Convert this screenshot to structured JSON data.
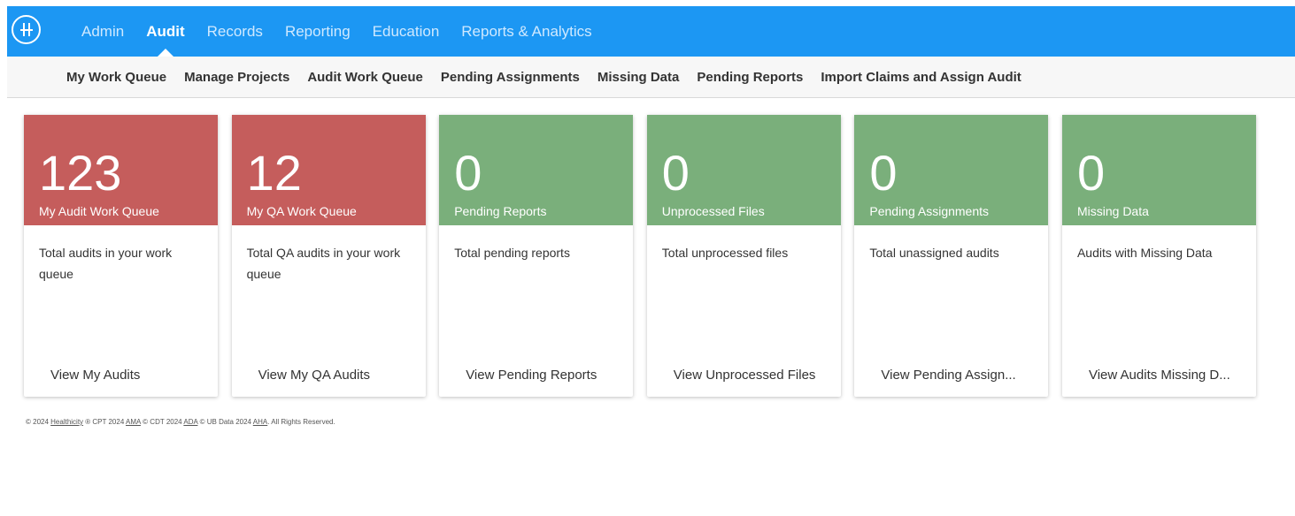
{
  "colors": {
    "topbar": "#1c97f3",
    "red": "#c55d5c",
    "green": "#7aaf7b"
  },
  "mainnav": [
    {
      "label": "Admin",
      "active": false
    },
    {
      "label": "Audit",
      "active": true
    },
    {
      "label": "Records",
      "active": false
    },
    {
      "label": "Reporting",
      "active": false
    },
    {
      "label": "Education",
      "active": false
    },
    {
      "label": "Reports & Analytics",
      "active": false
    }
  ],
  "subnav": [
    "My Work Queue",
    "Manage Projects",
    "Audit Work Queue",
    "Pending Assignments",
    "Missing Data",
    "Pending Reports",
    "Import Claims and Assign Audit"
  ],
  "cards": [
    {
      "count": "123",
      "title": "My Audit Work Queue",
      "desc": "Total audits in your work queue",
      "link": "View My Audits",
      "color": "red"
    },
    {
      "count": "12",
      "title": "My QA Work Queue",
      "desc": "Total QA audits in your work queue",
      "link": "View My QA Audits",
      "color": "red"
    },
    {
      "count": "0",
      "title": "Pending Reports",
      "desc": "Total pending reports",
      "link": "View Pending Reports",
      "color": "green"
    },
    {
      "count": "0",
      "title": "Unprocessed Files",
      "desc": "Total unprocessed files",
      "link": "View Unprocessed Files",
      "color": "green"
    },
    {
      "count": "0",
      "title": "Pending Assignments",
      "desc": "Total unassigned audits",
      "link": "View Pending Assign...",
      "color": "green"
    },
    {
      "count": "0",
      "title": "Missing Data",
      "desc": "Audits with Missing Data",
      "link": "View Audits Missing D...",
      "color": "green"
    }
  ],
  "footer": {
    "p1": "© 2024 ",
    "healthicity": "Healthicity",
    "p2": " ® CPT 2024 ",
    "ama": "AMA",
    "p3": " © CDT 2024 ",
    "ada": "ADA",
    "p4": " © UB Data 2024 ",
    "aha": "AHA",
    "p5": ". All Rights Reserved."
  }
}
